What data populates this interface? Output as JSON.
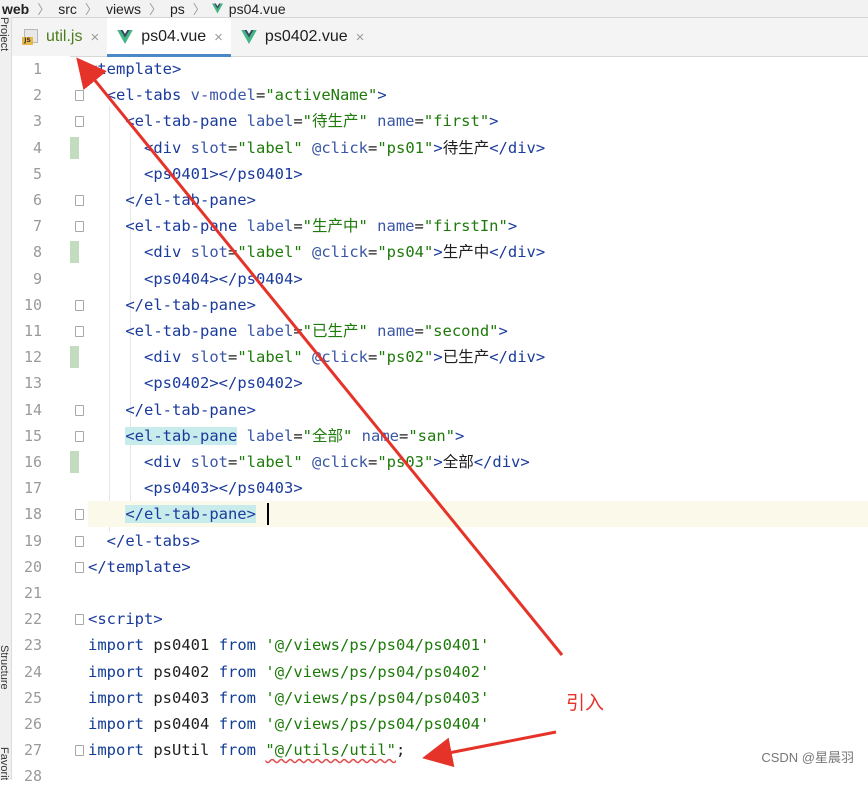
{
  "breadcrumb": {
    "items": [
      "web",
      "src",
      "views",
      "ps",
      "ps04.vue"
    ],
    "separator": "〉"
  },
  "sidebar": {
    "top_label": "Project",
    "mid_label": "Structure",
    "bottom_label": "Favorites"
  },
  "tabs": [
    {
      "label": "util.js",
      "type": "js",
      "active": false
    },
    {
      "label": "ps04.vue",
      "type": "vue",
      "active": true
    },
    {
      "label": "ps0402.vue",
      "type": "vue",
      "active": false
    }
  ],
  "tab_close_glyph": "×",
  "line_numbers": [
    "1",
    "2",
    "3",
    "4",
    "5",
    "6",
    "7",
    "8",
    "9",
    "10",
    "11",
    "12",
    "13",
    "14",
    "15",
    "16",
    "17",
    "18",
    "19",
    "20",
    "21",
    "22",
    "23",
    "24",
    "25",
    "26",
    "27",
    "28"
  ],
  "code_lines": [
    "<template>",
    "  <el-tabs v-model=\"activeName\">",
    "    <el-tab-pane label=\"待生产\" name=\"first\">",
    "      <div slot=\"label\" @click=\"ps01\">待生产</div>",
    "      <ps0401></ps0401>",
    "    </el-tab-pane>",
    "    <el-tab-pane label=\"生产中\" name=\"firstIn\">",
    "      <div slot=\"label\" @click=\"ps04\">生产中</div>",
    "      <ps0404></ps0404>",
    "    </el-tab-pane>",
    "    <el-tab-pane label=\"已生产\" name=\"second\">",
    "      <div slot=\"label\" @click=\"ps02\">已生产</div>",
    "      <ps0402></ps0402>",
    "    </el-tab-pane>",
    "    <el-tab-pane label=\"全部\" name=\"san\">",
    "      <div slot=\"label\" @click=\"ps03\">全部</div>",
    "      <ps0403></ps0403>",
    "    </el-tab-pane>",
    "  </el-tabs>",
    "</template>",
    "",
    "<script>",
    "import ps0401 from '@/views/ps/ps04/ps0401'",
    "import ps0402 from '@/views/ps/ps04/ps0402'",
    "import ps0403 from '@/views/ps/ps04/ps0403'",
    "import ps0404 from '@/views/ps/ps04/ps0404'",
    "import psUtil from \"@/utils/util\";",
    ""
  ],
  "current_line": 18,
  "annotation": {
    "text": "引入",
    "color": "#e5332a"
  },
  "watermark": "CSDN @星晨羽",
  "colors": {
    "tag": "#1a3b9b",
    "string": "#1e7a0a",
    "keyword": "#123d95",
    "active_tab_underline": "#4a88c7",
    "vue_green": "#41b883",
    "vue_dark": "#35495e"
  }
}
